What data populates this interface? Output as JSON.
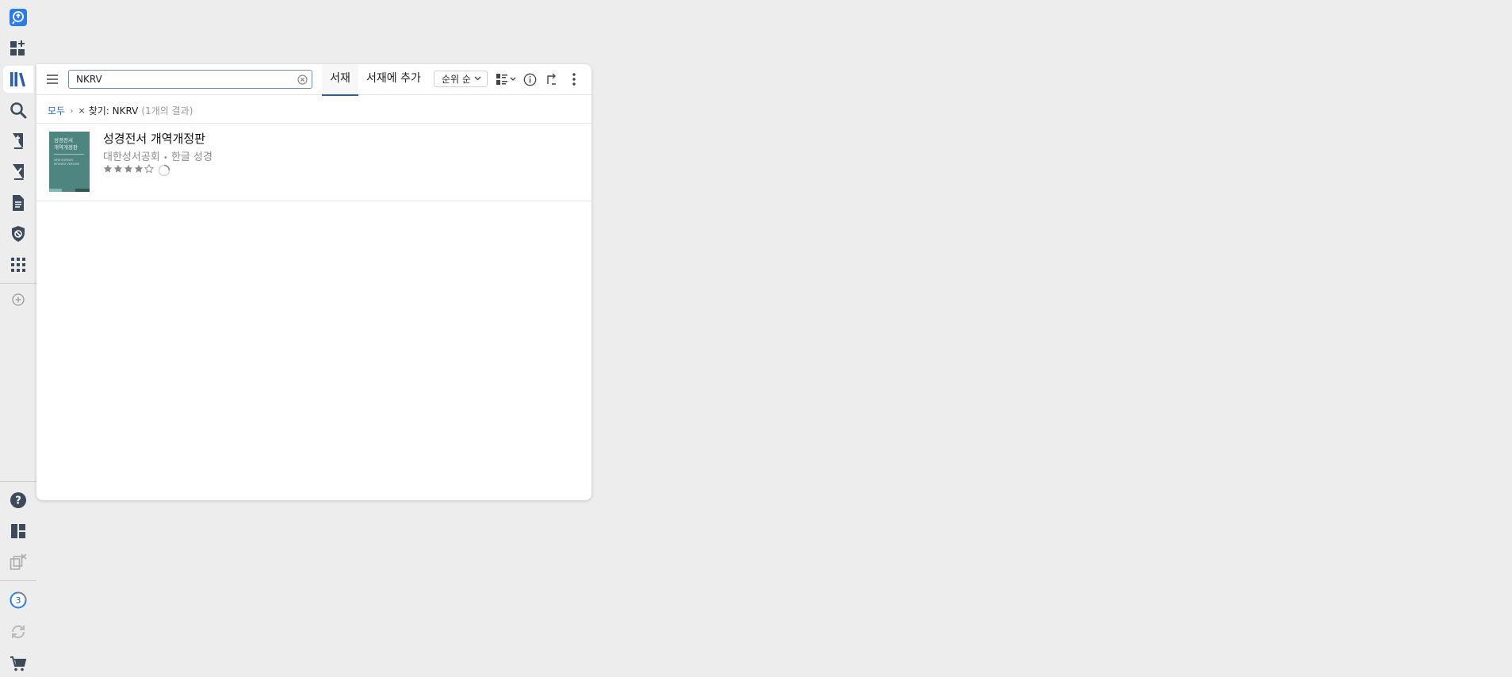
{
  "sidebar": {
    "top_icons": [
      "guide-icon",
      "layout-add-icon",
      "library-icon",
      "search-icon",
      "bible-icon",
      "reading-plan-icon",
      "document-icon",
      "shield-icon",
      "apps-icon"
    ],
    "add_icon": "add-circle-icon",
    "bottom_icons": [
      "help-icon",
      "layouts-icon",
      "close-panels-icon"
    ],
    "notification_count": "3",
    "sync_icon": "sync-icon",
    "cart_icon": "cart-icon"
  },
  "toolbar": {
    "search_value": "NKRV",
    "tab_library": "서재",
    "tab_add": "서재에 추가",
    "sort_label": "순위 순"
  },
  "breadcrumb": {
    "all": "모두",
    "filter": "찾기: NKRV",
    "count": "(1개의 결과)"
  },
  "results": [
    {
      "title": "성경전서 개역개정판",
      "publisher": "대한성서공회",
      "separator": "•",
      "type": "한글 성경",
      "rating": 4,
      "rating_max": 5,
      "cover": {
        "line1": "성경전서",
        "line2": "개역개정판",
        "sub1": "NEW KOREAN",
        "sub2": "REVISED VERSION",
        "color": "#4f8580"
      }
    }
  ],
  "colors": {
    "accent": "#2f5f95",
    "link": "#2f6bb7",
    "icon": "#3d4a5c"
  }
}
